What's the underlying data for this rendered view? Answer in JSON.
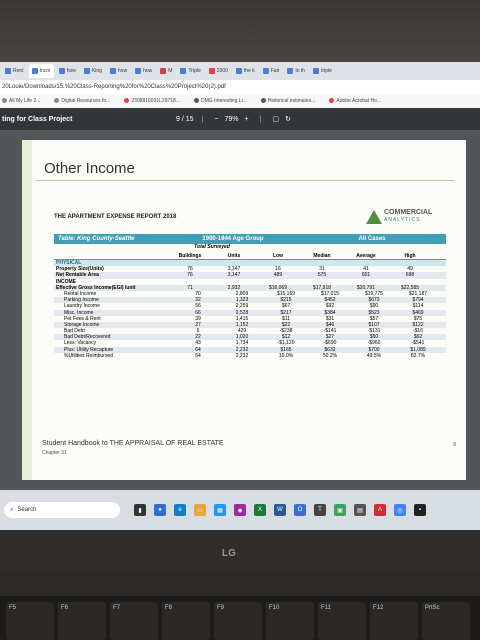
{
  "browser": {
    "tabs": [
      {
        "label": "Rent",
        "color": "#4a7ed6"
      },
      {
        "label": "Incor",
        "color": "#4a7ed6"
      },
      {
        "label": "how",
        "color": "#4a7ed6"
      },
      {
        "label": "King",
        "color": "#4a7ed6"
      },
      {
        "label": "how",
        "color": "#4a7ed6"
      },
      {
        "label": "how",
        "color": "#4a7ed6"
      },
      {
        "label": "M",
        "color": "#c44"
      },
      {
        "label": "Triple",
        "color": "#4a7ed6"
      },
      {
        "label": "2300",
        "color": "#d44"
      },
      {
        "label": "the k",
        "color": "#4a7ed6"
      },
      {
        "label": "Fair",
        "color": "#4a7ed6"
      },
      {
        "label": "In th",
        "color": "#4a7ed6"
      },
      {
        "label": "triple",
        "color": "#4a7ed6"
      }
    ],
    "address": "20Louie/Downloads/15.%20Class-Reporting%20for%20Class%20Project%20(2).pdf",
    "bookmarks": [
      "All My Life 2...",
      "Digital Resources fo...",
      "2308816031L29718...",
      "DMG Interesting Li...",
      "Historical estimates...",
      "Adobe Acrobat Ho..."
    ]
  },
  "pdf_toolbar": {
    "title": "ting for Class Project",
    "page": "9",
    "page_total": "/ 15",
    "zoom": "79%"
  },
  "page": {
    "heading": "Other Income",
    "report_title": "THE APARTMENT EXPENSE REPORT 2018",
    "logo_main": "COMMERCIAL",
    "logo_sub": "ANALYTICS",
    "table_region": "Table: King County-Seattle",
    "age_group": "1900-1944 Age Group",
    "all_cases": "All Cases",
    "total_surveyed": "Total Surveyed",
    "col_headers": [
      "Buildings",
      "Units",
      "Low",
      "Median",
      "Average",
      "High"
    ],
    "rows": [
      {
        "label": "PHYSICAL",
        "type": "physical",
        "vals": [
          "",
          "",
          "",
          "",
          "",
          ""
        ]
      },
      {
        "label": "Property Size(Units)",
        "type": "bold",
        "vals": [
          "76",
          "3,147",
          "16",
          "31",
          "41",
          "49"
        ]
      },
      {
        "label": "Net Rentable Area",
        "type": "bold",
        "vals": [
          "76",
          "3,147",
          "489",
          "575",
          "601",
          "698"
        ]
      },
      {
        "label": "INCOME",
        "type": "sect",
        "vals": [
          "",
          "",
          "",
          "",
          "",
          ""
        ]
      },
      {
        "label": "Effective Gross Income(EGI) /unit",
        "type": "bold",
        "vals": [
          "71",
          "2,932",
          "$16,069",
          "$17,918",
          "$20,791",
          "$22,585"
        ]
      },
      {
        "label": "Rental Income",
        "type": "ind",
        "vals": [
          "70",
          "2,809",
          "$15,169",
          "$17,015",
          "$19,775",
          "$21,187"
        ]
      },
      {
        "label": "Parking Income",
        "type": "ind",
        "vals": [
          "32",
          "1,323",
          "$215",
          "$452",
          "$673",
          "$794"
        ]
      },
      {
        "label": "Laundry Income",
        "type": "ind",
        "vals": [
          "56",
          "2,259",
          "$67",
          "$92",
          "$90",
          "$114"
        ]
      },
      {
        "label": "Misc. Income",
        "type": "ind",
        "vals": [
          "66",
          "2,528",
          "$217",
          "$384",
          "$523",
          "$469"
        ]
      },
      {
        "label": "Pet Fees & Rent",
        "type": "ind",
        "vals": [
          "39",
          "1,415",
          "$11",
          "$31",
          "$57",
          "$75"
        ]
      },
      {
        "label": "Storage Income",
        "type": "ind",
        "vals": [
          "27",
          "1,152",
          "$22",
          "$46",
          "$107",
          "$122"
        ]
      },
      {
        "label": "Bad Debt",
        "type": "ind",
        "vals": [
          "6",
          "429",
          "-$238",
          "-$141",
          "-$131",
          "-$16"
        ]
      },
      {
        "label": "Bad Debt/Recovered",
        "type": "ind",
        "vals": [
          "22",
          "1,020",
          "$12",
          "$27",
          "$50",
          "$62"
        ]
      },
      {
        "label": "Less: Vacancy",
        "type": "ind",
        "vals": [
          "43",
          "1,734",
          "-$1,120",
          "-$690",
          "-$960",
          "-$541"
        ]
      },
      {
        "label": "Plus: Utility Recapture",
        "type": "ind",
        "vals": [
          "64",
          "2,232",
          "$165",
          "$632",
          "$700",
          "$1,089"
        ]
      },
      {
        "label": "%Utilities Reimbursed",
        "type": "ind",
        "vals": [
          "64",
          "2,232",
          "10.0%",
          "50.2%",
          "49.5%",
          "82.7%"
        ]
      }
    ],
    "footer_line1": "Student Handbook to THE APPRAISAL OF REAL ESTATE",
    "footer_line2": "Chapter 31",
    "page_number": "9"
  },
  "taskbar": {
    "search_label": "Search"
  },
  "brand": "LG",
  "keys": [
    "F5",
    "F6",
    "F7",
    "F8",
    "F9",
    "F10",
    "F11",
    "F12",
    "PrtSc"
  ]
}
